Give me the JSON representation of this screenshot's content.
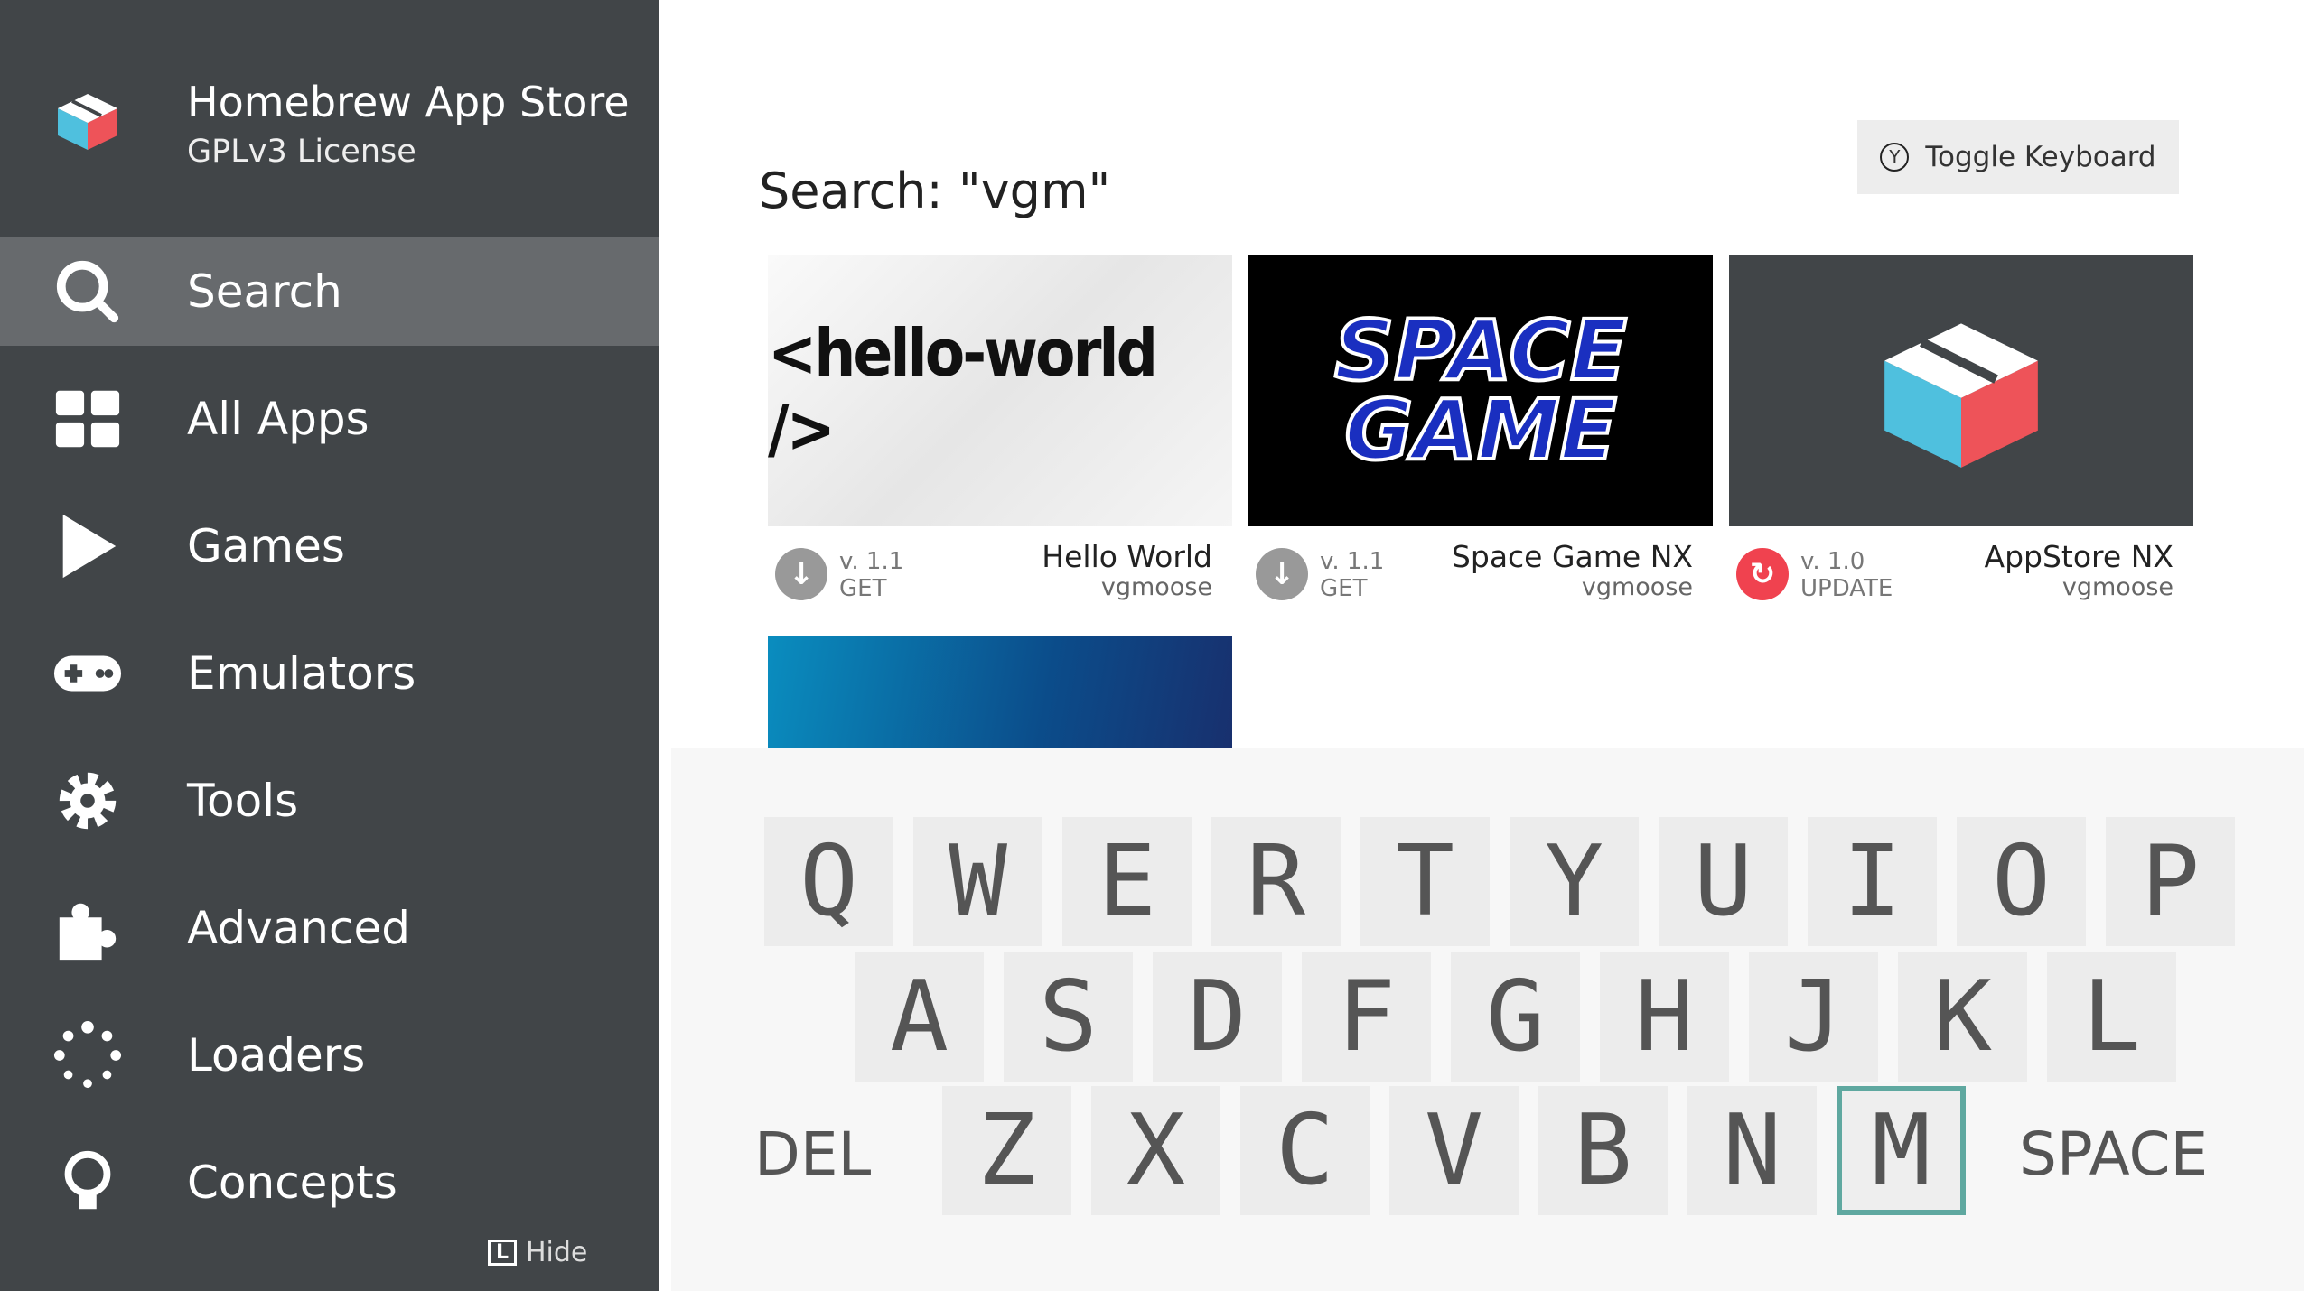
{
  "sidebar": {
    "title": "Homebrew App Store",
    "subtitle": "GPLv3 License",
    "items": [
      {
        "label": "Search",
        "icon": "search-icon",
        "selected": true
      },
      {
        "label": "All Apps",
        "icon": "grid-icon"
      },
      {
        "label": "Games",
        "icon": "play-icon"
      },
      {
        "label": "Emulators",
        "icon": "gamepad-icon"
      },
      {
        "label": "Tools",
        "icon": "gear-icon"
      },
      {
        "label": "Advanced",
        "icon": "puzzle-icon"
      },
      {
        "label": "Loaders",
        "icon": "loader-icon"
      },
      {
        "label": "Concepts",
        "icon": "lightbulb-icon"
      }
    ],
    "hide_key": "L",
    "hide_label": "Hide"
  },
  "main": {
    "title": "Search: \"vgm\"",
    "toggle_key": "Y",
    "toggle_label": "Toggle Keyboard",
    "apps": [
      {
        "name": "Hello World",
        "author": "vgmoose",
        "version": "v. 1.1",
        "action": "GET",
        "thumb_text": "<hello-world />"
      },
      {
        "name": "Space Game NX",
        "author": "vgmoose",
        "version": "v. 1.1",
        "action": "GET",
        "thumb_text": "SPACE GAME"
      },
      {
        "name": "AppStore NX",
        "author": "vgmoose",
        "version": "v. 1.0",
        "action": "UPDATE"
      }
    ]
  },
  "keyboard": {
    "rows": [
      [
        "Q",
        "W",
        "E",
        "R",
        "T",
        "Y",
        "U",
        "I",
        "O",
        "P"
      ],
      [
        "A",
        "S",
        "D",
        "F",
        "G",
        "H",
        "J",
        "K",
        "L"
      ],
      [
        "Z",
        "X",
        "C",
        "V",
        "B",
        "N",
        "M"
      ]
    ],
    "selected": "M",
    "del": "DEL",
    "space": "SPACE"
  },
  "colors": {
    "sidebar": "#414548",
    "selected": "#676a6d",
    "update": "#f0424f",
    "highlight": "#5fa8a0"
  }
}
